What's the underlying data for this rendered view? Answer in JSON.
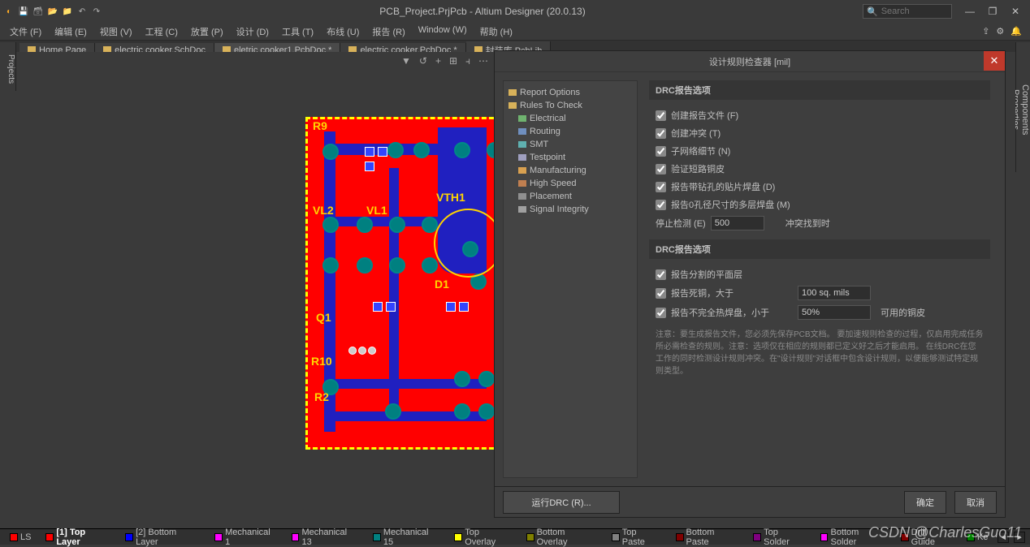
{
  "title": "PCB_Project.PrjPcb - Altium Designer (20.0.13)",
  "search_placeholder": "Search",
  "menu": [
    "文件 (F)",
    "编辑 (E)",
    "视图 (V)",
    "工程 (C)",
    "放置 (P)",
    "设计 (D)",
    "工具 (T)",
    "布线 (U)",
    "报告 (R)",
    "Window (W)",
    "帮助 (H)"
  ],
  "tabs": [
    {
      "label": "Home Page",
      "active": false
    },
    {
      "label": "electric cooker.SchDoc",
      "active": false
    },
    {
      "label": "eletric cooker1.PcbDoc *",
      "active": true
    },
    {
      "label": "electric cooker.PcbDoc *",
      "active": false
    },
    {
      "label": "封装库.PcbLib",
      "active": false
    }
  ],
  "left_tab": "Projects",
  "right_tabs": [
    "Components",
    "Properties"
  ],
  "silk": {
    "r9": "R9",
    "vl2": "VL2",
    "vl1": "VL1",
    "vth1": "VTH1",
    "d1": "D1",
    "q1": "Q1",
    "r10": "R10",
    "r2": "R2"
  },
  "dialog": {
    "title": "设计规则检查器 [mil]",
    "tree": [
      {
        "label": "Report Options",
        "root": true,
        "color": "#d8b25a"
      },
      {
        "label": "Rules To Check",
        "root": true,
        "color": "#d8b25a"
      },
      {
        "label": "Electrical",
        "color": "#6fb36f"
      },
      {
        "label": "Routing",
        "color": "#6f8fbf"
      },
      {
        "label": "SMT",
        "color": "#5fb0b0"
      },
      {
        "label": "Testpoint",
        "color": "#9f9fbf"
      },
      {
        "label": "Manufacturing",
        "color": "#d8a050"
      },
      {
        "label": "High Speed",
        "color": "#c07f50"
      },
      {
        "label": "Placement",
        "color": "#8f8f8f"
      },
      {
        "label": "Signal Integrity",
        "color": "#9f9f9f"
      }
    ],
    "section1": "DRC报告选项",
    "checks1": [
      "创建报告文件 (F)",
      "创建冲突 (T)",
      "子网络细节 (N)",
      "验证短路铜皮",
      "报告带钻孔的贴片焊盘 (D)",
      "报告0孔径尺寸的多层焊盘 (M)"
    ],
    "stop_label": "停止检测 (E)",
    "stop_value": "500",
    "stop_after": "冲突找到时",
    "section2": "DRC报告选项",
    "checks2": [
      "报告分割的平面层",
      "报告死铜，大于",
      "报告不完全热焊盘，小于"
    ],
    "val_dead": "100 sq. mils",
    "val_therm": "50%",
    "therm_suffix": "可用的铜皮",
    "note": "注意：要生成报告文件，您必须先保存PCB文档。\n要加速规则检查的过程，仅启用完成任务所必需检查的规则。注意：选项仅在相应的规则都已定义好之后才能启用。\n在线DRC在您工作的同时检测设计规则冲突。在\"设计规则\"对话框中包含设计规则，以便能够测试特定规则类型。",
    "run_btn": "运行DRC (R)...",
    "ok": "确定",
    "cancel": "取消"
  },
  "layers": [
    {
      "label": "LS",
      "color": "#ff0000"
    },
    {
      "label": "[1] Top Layer",
      "color": "#ff0000",
      "bold": true
    },
    {
      "label": "[2] Bottom Layer",
      "color": "#0000ff"
    },
    {
      "label": "Mechanical 1",
      "color": "#ff00ff"
    },
    {
      "label": "Mechanical 13",
      "color": "#ff00ff"
    },
    {
      "label": "Mechanical 15",
      "color": "#008080"
    },
    {
      "label": "Top Overlay",
      "color": "#ffff00"
    },
    {
      "label": "Bottom Overlay",
      "color": "#808000"
    },
    {
      "label": "Top Paste",
      "color": "#808080"
    },
    {
      "label": "Bottom Paste",
      "color": "#800000"
    },
    {
      "label": "Top Solder",
      "color": "#800080"
    },
    {
      "label": "Bottom Solder",
      "color": "#ff00ff"
    },
    {
      "label": "Drill Guide",
      "color": "#800000"
    },
    {
      "label": "Ke",
      "color": "#008000"
    }
  ],
  "watermark": "CSDN @CharlesGuo11"
}
